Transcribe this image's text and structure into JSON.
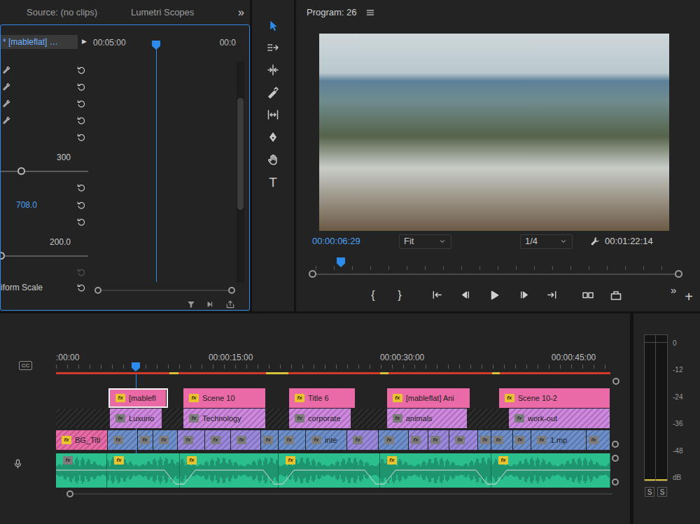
{
  "effect_controls": {
    "tabs": [
      {
        "label": "Source: (no clips)",
        "selected": false
      },
      {
        "label": "Lumetri Scopes",
        "selected": false
      }
    ],
    "overflow": "»",
    "clip": "* [mableflat] …",
    "play": "▶",
    "ruler": [
      "00:05:00",
      "00:0"
    ],
    "playhead": 0.45,
    "rows": [
      {
        "kind": "picker",
        "disabled": false
      },
      {
        "kind": "picker",
        "disabled": false
      },
      {
        "kind": "picker",
        "disabled": false
      },
      {
        "kind": "picker",
        "disabled": false
      },
      {
        "kind": "reset",
        "disabled": false
      },
      {
        "kind": "range",
        "max": "300",
        "level": 0.24,
        "disabled": false
      },
      {
        "kind": "reset",
        "disabled": false
      },
      {
        "kind": "value",
        "value": "708.0",
        "disabled": false
      },
      {
        "kind": "reset",
        "disabled": false
      },
      {
        "kind": "range",
        "max": "200.0",
        "level": 0,
        "disabled": false
      },
      {
        "kind": "reset",
        "disabled": true
      },
      {
        "kind": "label",
        "label": "iform Scale",
        "disabled": false
      }
    ]
  },
  "tools": [
    {
      "kind": "selection",
      "selected": true
    },
    {
      "kind": "track-select",
      "selected": false
    },
    {
      "kind": "ripple",
      "selected": false
    },
    {
      "kind": "razor",
      "selected": false
    },
    {
      "kind": "slip",
      "selected": false
    },
    {
      "kind": "pen",
      "selected": false
    },
    {
      "kind": "hand",
      "selected": false
    },
    {
      "kind": "type",
      "label": "T",
      "selected": false
    }
  ],
  "program": {
    "title": "Program: 26",
    "timecode": "00:00:06:29",
    "zoom": "Fit",
    "resolution": "1/4",
    "duration": "00:01:22:14",
    "playhead": 0.07,
    "transport": [
      {
        "kind": "mark-in",
        "label": "{"
      },
      {
        "kind": "mark-out",
        "label": "}"
      },
      {
        "kind": "go-in"
      },
      {
        "kind": "step-back"
      },
      {
        "kind": "play"
      },
      {
        "kind": "step-forward"
      },
      {
        "kind": "go-out"
      },
      {
        "kind": "compare"
      },
      {
        "kind": "export-frame"
      }
    ],
    "overflow": "»",
    "add": "+"
  },
  "timeline": {
    "captions": "CC",
    "badge": "fx",
    "ruler": [
      {
        "label": ":00:00",
        "time": 0
      },
      {
        "label": "00:00:15:00",
        "time": 15
      },
      {
        "label": "00:00:30:00",
        "time": 30
      },
      {
        "label": "00:00:45:00",
        "time": 45
      }
    ],
    "playhead": 8.63,
    "render": [
      {
        "start": 1.65,
        "end": 50.15,
        "color": "#d23a2c"
      },
      {
        "start": 11.6,
        "end": 12.4,
        "color": "#d8c23a"
      },
      {
        "start": 20.0,
        "end": 22.0,
        "color": "#d8c23a"
      },
      {
        "start": 30.0,
        "end": 30.75,
        "color": "#d8c23a"
      },
      {
        "start": 39.8,
        "end": 40.5,
        "color": "#d8c23a"
      }
    ],
    "tracks": [
      {
        "kind": "plain",
        "clips": [
          {
            "label": "[mablefl",
            "start": 6.25,
            "end": 11.45,
            "color": "#e96aa7",
            "effects": true,
            "selected": true
          },
          {
            "label": "Scene 10",
            "start": 12.8,
            "end": 20.0,
            "color": "#e96aa7",
            "effects": true,
            "selected": false
          },
          {
            "label": "Title 6",
            "start": 22.05,
            "end": 27.86,
            "color": "#e96aa7",
            "effects": true,
            "selected": false
          },
          {
            "label": "[mableflat] Ani",
            "start": 30.6,
            "end": 37.9,
            "color": "#e96aa7",
            "effects": true,
            "selected": false
          },
          {
            "label": "Scene 10-2",
            "start": 40.4,
            "end": 50.15,
            "color": "#e96aa7",
            "effects": true,
            "selected": false
          }
        ]
      },
      {
        "kind": "hatched",
        "clips": [
          {
            "label": "Luxurio",
            "start": 6.37,
            "end": 10.96,
            "color": "#cf88df",
            "effects": false,
            "selected": false
          },
          {
            "label": "Technology",
            "start": 12.8,
            "end": 20.0,
            "color": "#cf88df",
            "effects": false,
            "selected": false
          },
          {
            "label": "corporate",
            "start": 22.05,
            "end": 27.5,
            "color": "#cf88df",
            "effects": false,
            "selected": false
          },
          {
            "label": "animals",
            "start": 30.6,
            "end": 37.66,
            "color": "#cf88df",
            "effects": false,
            "selected": false
          },
          {
            "label": "work-out",
            "start": 41.27,
            "end": 50.15,
            "color": "#cf88df",
            "effects": false,
            "selected": false
          }
        ]
      },
      {
        "kind": "hatched",
        "clips": [
          {
            "label": "BG_Titl",
            "start": 1.65,
            "end": 6.18,
            "color": "#e96aa7",
            "effects": true,
            "selected": false
          },
          {
            "label": "",
            "start": 6.18,
            "end": 8.82,
            "color": "#6d8fcc",
            "effects": false,
            "selected": false
          },
          {
            "label": "",
            "start": 8.82,
            "end": 10.17,
            "color": "#6d8fcc",
            "effects": false,
            "selected": false
          },
          {
            "label": "",
            "start": 10.17,
            "end": 12.31,
            "color": "#6d8fcc",
            "effects": false,
            "selected": false
          },
          {
            "label": "",
            "start": 12.31,
            "end": 14.7,
            "color": "#9b88dd",
            "effects": false,
            "selected": false
          },
          {
            "label": "",
            "start": 14.7,
            "end": 16.96,
            "color": "#9b88dd",
            "effects": false,
            "selected": false
          },
          {
            "label": "",
            "start": 16.96,
            "end": 19.6,
            "color": "#9b88dd",
            "effects": false,
            "selected": false
          },
          {
            "label": "",
            "start": 19.6,
            "end": 21.13,
            "color": "#6d8fcc",
            "effects": false,
            "selected": false
          },
          {
            "label": "",
            "start": 21.13,
            "end": 23.51,
            "color": "#6d8fcc",
            "effects": false,
            "selected": false
          },
          {
            "label": "inte",
            "start": 23.51,
            "end": 27.13,
            "color": "#6d8fcc",
            "effects": false,
            "selected": false
          },
          {
            "label": "",
            "start": 27.13,
            "end": 29.88,
            "color": "#9b88dd",
            "effects": false,
            "selected": false
          },
          {
            "label": "",
            "start": 29.88,
            "end": 32.52,
            "color": "#6d8fcc",
            "effects": false,
            "selected": false
          },
          {
            "label": "",
            "start": 32.52,
            "end": 34.23,
            "color": "#9b88dd",
            "effects": false,
            "selected": false
          },
          {
            "label": "",
            "start": 34.23,
            "end": 36.07,
            "color": "#9b88dd",
            "effects": false,
            "selected": false
          },
          {
            "label": "",
            "start": 36.07,
            "end": 38.58,
            "color": "#9b88dd",
            "effects": false,
            "selected": false
          },
          {
            "label": "",
            "start": 38.58,
            "end": 39.74,
            "color": "#6d8fcc",
            "effects": false,
            "selected": false
          },
          {
            "label": "",
            "start": 39.74,
            "end": 41.64,
            "color": "#6d8fcc",
            "effects": false,
            "selected": false
          },
          {
            "label": "",
            "start": 41.64,
            "end": 43.23,
            "color": "#6d8fcc",
            "effects": false,
            "selected": false
          },
          {
            "label": "1.mp",
            "start": 43.23,
            "end": 48.07,
            "color": "#6d8fcc",
            "effects": false,
            "selected": false
          },
          {
            "label": "",
            "start": 48.07,
            "end": 50.15,
            "color": "#6d8fcc",
            "effects": false,
            "selected": false
          }
        ]
      },
      {
        "kind": "audio",
        "clips": [
          {
            "start": 1.65,
            "end": 6.12,
            "color": "#2bbf8e",
            "effects": false,
            "selected": false
          },
          {
            "start": 6.12,
            "end": 12.49,
            "color": "#2bbf8e",
            "effects": true,
            "selected": false
          },
          {
            "start": 12.49,
            "end": 21.13,
            "color": "#2bbf8e",
            "effects": true,
            "selected": false
          },
          {
            "start": 21.13,
            "end": 30.0,
            "color": "#2bbf8e",
            "effects": true,
            "selected": false
          },
          {
            "start": 30.0,
            "end": 39.74,
            "color": "#2bbf8e",
            "effects": true,
            "selected": false
          },
          {
            "start": 39.74,
            "end": 50.15,
            "color": "#2bbf8e",
            "effects": true,
            "selected": false
          }
        ]
      }
    ]
  },
  "audio_meter": {
    "scale": [
      "0",
      "-12",
      "-24",
      "-36",
      "-48",
      "dB"
    ],
    "channels": [
      {
        "level": 0.01
      },
      {
        "level": 0.01
      }
    ],
    "solo": [
      "S",
      "S"
    ]
  }
}
